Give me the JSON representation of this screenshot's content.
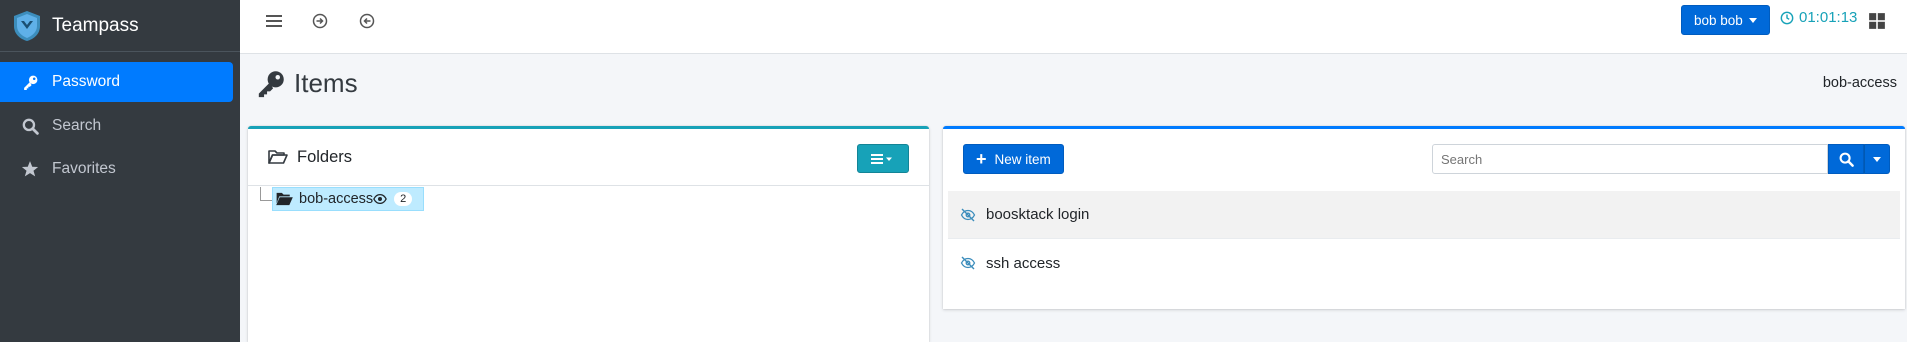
{
  "app": {
    "brand": "Teampass"
  },
  "sidebar": {
    "items": [
      {
        "label": "Password",
        "icon": "key-icon",
        "active": true
      },
      {
        "label": "Search",
        "icon": "search-icon",
        "active": false
      },
      {
        "label": "Favorites",
        "icon": "star-icon",
        "active": false
      }
    ]
  },
  "topbar": {
    "user_label": "bob bob",
    "timer": "01:01:13"
  },
  "page": {
    "title": "Items",
    "breadcrumb": "bob-access"
  },
  "folders": {
    "title": "Folders",
    "tree": [
      {
        "label": "bob-access",
        "count": "2"
      }
    ]
  },
  "items_panel": {
    "new_item_label": "New item",
    "search_placeholder": "Search",
    "items": [
      {
        "label": "boosktack login"
      },
      {
        "label": "ssh access"
      }
    ]
  },
  "colors": {
    "sidebar_bg": "#343a40",
    "primary": "#007bff",
    "info": "#17a2b8",
    "page_bg": "#f4f6f9"
  }
}
